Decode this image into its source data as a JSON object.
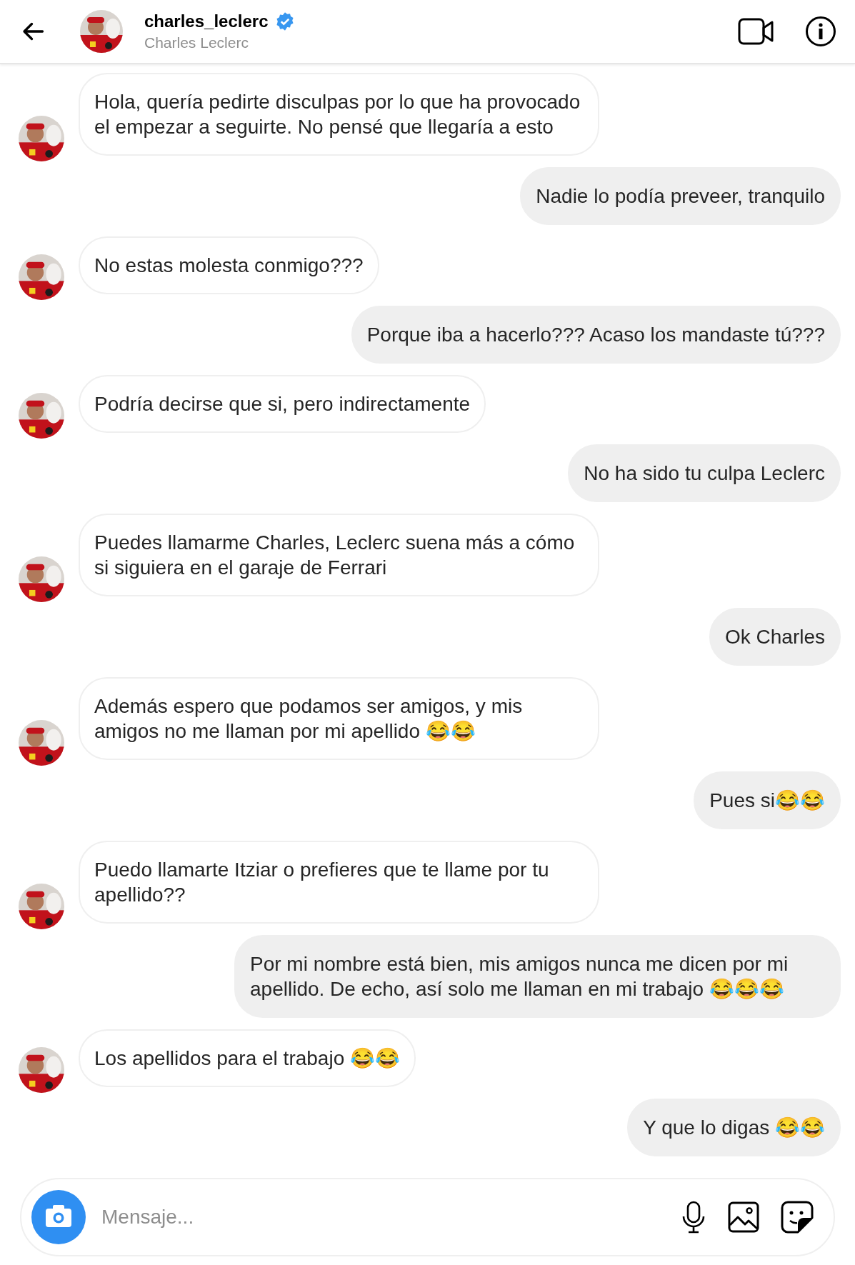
{
  "header": {
    "username": "charles_leclerc",
    "verified": true,
    "full_name": "Charles Leclerc"
  },
  "messages": [
    {
      "kind": "received",
      "text": "Hola, quería pedirte disculpas por lo que ha provocado el empezar a seguirte. No pensé que llegaría a esto"
    },
    {
      "kind": "sent",
      "text": "Nadie lo podía preveer, tranquilo"
    },
    {
      "kind": "received",
      "text": "No estas molesta conmigo???"
    },
    {
      "kind": "sent",
      "text": "Porque iba a hacerlo??? Acaso los mandaste tú???"
    },
    {
      "kind": "received",
      "text": "Podría decirse que si, pero indirectamente"
    },
    {
      "kind": "sent",
      "text": "No ha sido tu culpa Leclerc"
    },
    {
      "kind": "received",
      "text": "Puedes llamarme Charles, Leclerc suena más a cómo si siguiera en el garaje de Ferrari"
    },
    {
      "kind": "sent",
      "text": "Ok Charles"
    },
    {
      "kind": "received",
      "text": "Además espero que podamos ser amigos, y mis amigos no me llaman por mi apellido 😂😂"
    },
    {
      "kind": "sent",
      "text": "Pues si😂😂"
    },
    {
      "kind": "received",
      "text": "Puedo llamarte Itziar o prefieres que te llame por tu apellido??"
    },
    {
      "kind": "sent",
      "text": "Por mi nombre está bien, mis amigos nunca me dicen por mi apellido. De echo, así solo me llaman en mi trabajo 😂😂😂"
    },
    {
      "kind": "received",
      "text": "Los apellidos para el trabajo 😂😂"
    },
    {
      "kind": "sent",
      "text": "Y que lo digas 😂😂"
    }
  ],
  "composer": {
    "placeholder": "Mensaje..."
  }
}
